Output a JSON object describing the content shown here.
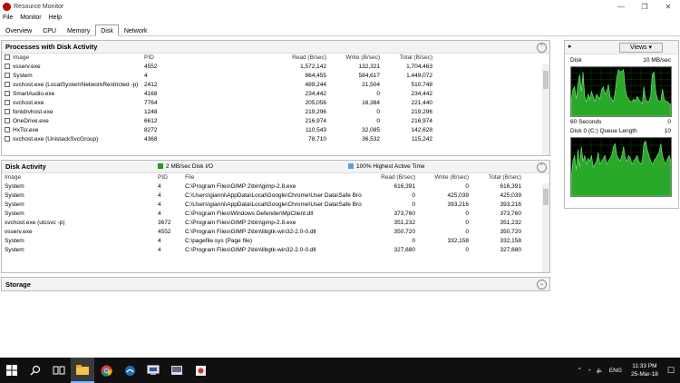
{
  "window": {
    "title": "Resource Monitor",
    "min_glyph": "—",
    "max_glyph": "❐",
    "close_glyph": "✕"
  },
  "menu": [
    "File",
    "Monitor",
    "Help"
  ],
  "tabs": [
    "Overview",
    "CPU",
    "Memory",
    "Disk",
    "Network"
  ],
  "active_tab": "Disk",
  "processes": {
    "title": "Processes with Disk Activity",
    "columns": [
      "Image",
      "PID",
      "Read (B/sec)",
      "Write (B/sec)",
      "Total (B/sec)"
    ],
    "rows": [
      [
        "vsserv.exe",
        "4552",
        "1,572,142",
        "132,321",
        "1,704,463"
      ],
      [
        "System",
        "4",
        "864,455",
        "584,617",
        "1,449,072"
      ],
      [
        "svchost.exe (LocalSystemNetworkRestricted -p)",
        "2412",
        "489,244",
        "21,504",
        "510,748"
      ],
      [
        "SmartAudio.exe",
        "4168",
        "234,442",
        "0",
        "234,442"
      ],
      [
        "svchost.exe",
        "7764",
        "205,056",
        "16,384",
        "221,440"
      ],
      [
        "fontdrvhost.exe",
        "1248",
        "219,296",
        "0",
        "219,296"
      ],
      [
        "OneDrive.exe",
        "6612",
        "216,974",
        "0",
        "216,974"
      ],
      [
        "HxTsr.exe",
        "8272",
        "110,543",
        "32,085",
        "142,628"
      ],
      [
        "svchost.exe (UnistackSvcGroup)",
        "4368",
        "78,710",
        "36,532",
        "115,242"
      ]
    ]
  },
  "disk_activity": {
    "title": "Disk Activity",
    "io_legend": "2 MB/sec Disk I/O",
    "active_legend": "100% Highest Active Time",
    "io_color": "#1e9e1e",
    "active_color": "#5aa0e0",
    "columns": [
      "Image",
      "PID",
      "File",
      "Read (B/sec)",
      "Write (B/sec)",
      "Total (B/sec)"
    ],
    "rows": [
      [
        "System",
        "4",
        "C:\\Program Files\\GIMP 2\\bin\\gimp-2.8.exe",
        "616,391",
        "0",
        "616,391"
      ],
      [
        "System",
        "4",
        "C:\\Users\\gianni\\AppData\\Local\\Google\\Chrome\\User Data\\Safe Browsi...",
        "0",
        "425,039",
        "425,039"
      ],
      [
        "System",
        "4",
        "C:\\Users\\gianni\\AppData\\Local\\Google\\Chrome\\User Data\\Safe Browsi...",
        "0",
        "393,216",
        "393,216"
      ],
      [
        "System",
        "4",
        "C:\\Program Files\\Windows Defender\\MpClient.dll",
        "373,760",
        "0",
        "373,760"
      ],
      [
        "svchost.exe (utcsvc -p)",
        "3672",
        "C:\\Program Files\\GIMP 2\\bin\\gimp-2.8.exe",
        "351,232",
        "0",
        "351,232"
      ],
      [
        "vsserv.exe",
        "4552",
        "C:\\Program Files\\GIMP 2\\bin\\libgtk-win32-2.0-0.dll",
        "350,720",
        "0",
        "350,720"
      ],
      [
        "System",
        "4",
        "C:\\pagefile.sys (Page file)",
        "0",
        "332,158",
        "332,158"
      ],
      [
        "System",
        "4",
        "C:\\Program Files\\GIMP 2\\bin\\libgtk-win32-2.0-0.dll",
        "327,680",
        "0",
        "327,680"
      ]
    ]
  },
  "storage": {
    "title": "Storage"
  },
  "right": {
    "views_label": "Views",
    "disk_label": "Disk",
    "disk_max": "10 MB/sec",
    "disk_bottom_left": "60 Seconds",
    "disk_bottom_right": "0",
    "queue_label": "Disk 0 (C:) Queue Length",
    "queue_max": "10",
    "disk_series": [
      0.3,
      0.55,
      0.6,
      0.35,
      0.65,
      0.85,
      0.5,
      0.9,
      0.4,
      0.3,
      0.45,
      0.35,
      0.5,
      0.4,
      0.3,
      0.45,
      0.4,
      0.35,
      0.55,
      0.6,
      0.45,
      0.5,
      0.65,
      0.4,
      0.35,
      0.3,
      0.5,
      0.8,
      0.95,
      0.9,
      0.92,
      0.95,
      0.55,
      0.4,
      0.35,
      0.3,
      0.3,
      0.35,
      0.3,
      0.4,
      0.35,
      0.3,
      0.25,
      0.6,
      0.35,
      0.3,
      0.3,
      0.4,
      0.85,
      0.9,
      0.5,
      0.35,
      0.3,
      0.3,
      0.55,
      0.35,
      0.3,
      0.3,
      0.25,
      0.25
    ],
    "queue_series": [
      0.3,
      0.6,
      0.7,
      0.45,
      0.8,
      0.5,
      0.85,
      0.6,
      0.7,
      0.55,
      0.65,
      0.6,
      0.7,
      0.5,
      0.55,
      0.6,
      0.75,
      0.55,
      0.6,
      0.65,
      0.7,
      0.55,
      0.6,
      0.65,
      0.7,
      0.85,
      0.9,
      0.7,
      0.65,
      0.6,
      0.7,
      0.85,
      0.65,
      0.6,
      0.7,
      0.65,
      0.55,
      0.6,
      0.65,
      0.7,
      0.6,
      0.55,
      0.6,
      0.9,
      0.95,
      0.8,
      0.7,
      0.6,
      0.55,
      0.6,
      0.65,
      0.7,
      0.75,
      0.9,
      0.7,
      0.6,
      0.55,
      0.65,
      0.7,
      0.6
    ]
  },
  "taskbar": {
    "time": "11:33 PM",
    "date": "25-Mar-18",
    "lang": "ENG",
    "apps": [
      "windows-start-icon",
      "search-icon",
      "task-view-icon",
      "file-explorer-icon",
      "chrome-icon",
      "app-icon",
      "app-icon",
      "app-icon",
      "app-icon"
    ]
  }
}
